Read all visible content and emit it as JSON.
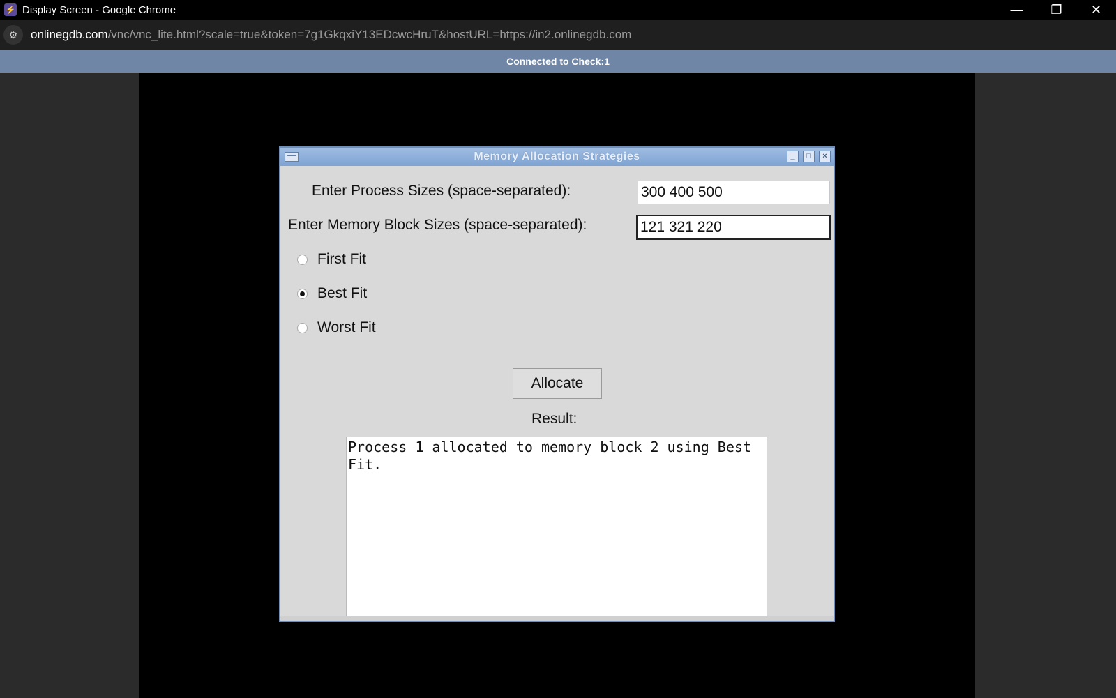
{
  "browser": {
    "window_title": "Display Screen - Google Chrome",
    "url_host": "onlinegdb.com",
    "url_rest": "/vnc/vnc_lite.html?scale=true&token=7g1GkqxiY13EDcwcHruT&hostURL=https://in2.onlinegdb.com",
    "controls": {
      "minimize": "—",
      "restore": "❐",
      "close": "✕"
    }
  },
  "vnc": {
    "status": "Connected to Check:1"
  },
  "app": {
    "title": "Memory Allocation Strategies",
    "process_label": "Enter Process Sizes (space-separated):",
    "process_value": "300 400 500",
    "block_label": "Enter Memory Block Sizes (space-separated):",
    "block_value": "121 321 220",
    "options": [
      {
        "label": "First Fit",
        "selected": false
      },
      {
        "label": "Best Fit",
        "selected": true
      },
      {
        "label": "Worst Fit",
        "selected": false
      }
    ],
    "allocate_label": "Allocate",
    "result_label": "Result:",
    "result_text": "Process 1 allocated to memory block 2 using Best Fit."
  },
  "icons": {
    "app_icon": "lightning-icon",
    "site_info": "tune-icon"
  }
}
